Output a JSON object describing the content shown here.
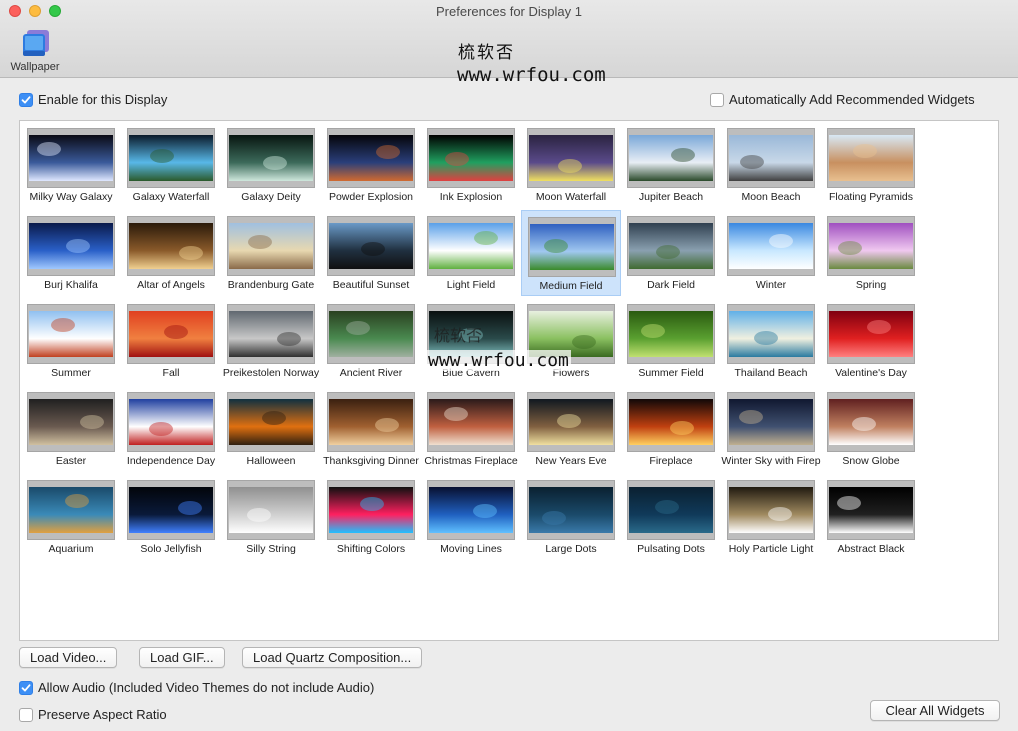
{
  "window": {
    "title": "Preferences for Display 1"
  },
  "toolbar": {
    "wallpaper_label": "Wallpaper"
  },
  "watermark": {
    "cn": "梳软否",
    "url": "www.wrfou.com"
  },
  "options": {
    "enable_label": "Enable for this Display",
    "enable_checked": true,
    "auto_widgets_label": "Automatically Add Recommended Widgets",
    "auto_widgets_checked": false,
    "allow_audio_label": "Allow Audio (Included Video Themes do not include Audio)",
    "allow_audio_checked": true,
    "preserve_aspect_label": "Preserve Aspect Ratio",
    "preserve_aspect_checked": false
  },
  "buttons": {
    "load_video": "Load Video...",
    "load_gif": "Load GIF...",
    "load_quartz": "Load Quartz Composition...",
    "clear_widgets": "Clear All Widgets"
  },
  "gallery": {
    "selected": "Medium Field",
    "items": [
      [
        "Milky Way Galaxy",
        "Galaxy Waterfall",
        "Galaxy Deity",
        "Powder Explosion",
        "Ink Explosion",
        "Moon Waterfall",
        "Jupiter Beach",
        "Moon Beach",
        "Floating Pyramids"
      ],
      [
        "Burj Khalifa",
        "Altar of Angels",
        "Brandenburg Gate",
        "Beautiful Sunset",
        "Light Field",
        "Medium Field",
        "Dark Field",
        "Winter",
        "Spring"
      ],
      [
        "Summer",
        "Fall",
        "Preikestolen Norway",
        "Ancient River",
        "Blue Cavern",
        "Flowers",
        "Summer Field",
        "Thailand Beach",
        "Valentine's Day"
      ],
      [
        "Easter",
        "Independence Day",
        "Halloween",
        "Thanksgiving Dinner",
        "Christmas Fireplace",
        "New Years Eve",
        "Fireplace",
        "Winter Sky with Firep",
        "Snow Globe"
      ],
      [
        "Aquarium",
        "Solo Jellyfish",
        "Silly String",
        "Shifting Colors",
        "Moving Lines",
        "Large Dots",
        "Pulsating Dots",
        "Holy Particle Light",
        "Abstract Black"
      ]
    ]
  },
  "colors": {
    "accent": "#3d8ff5",
    "selection": "#cde3fb"
  }
}
